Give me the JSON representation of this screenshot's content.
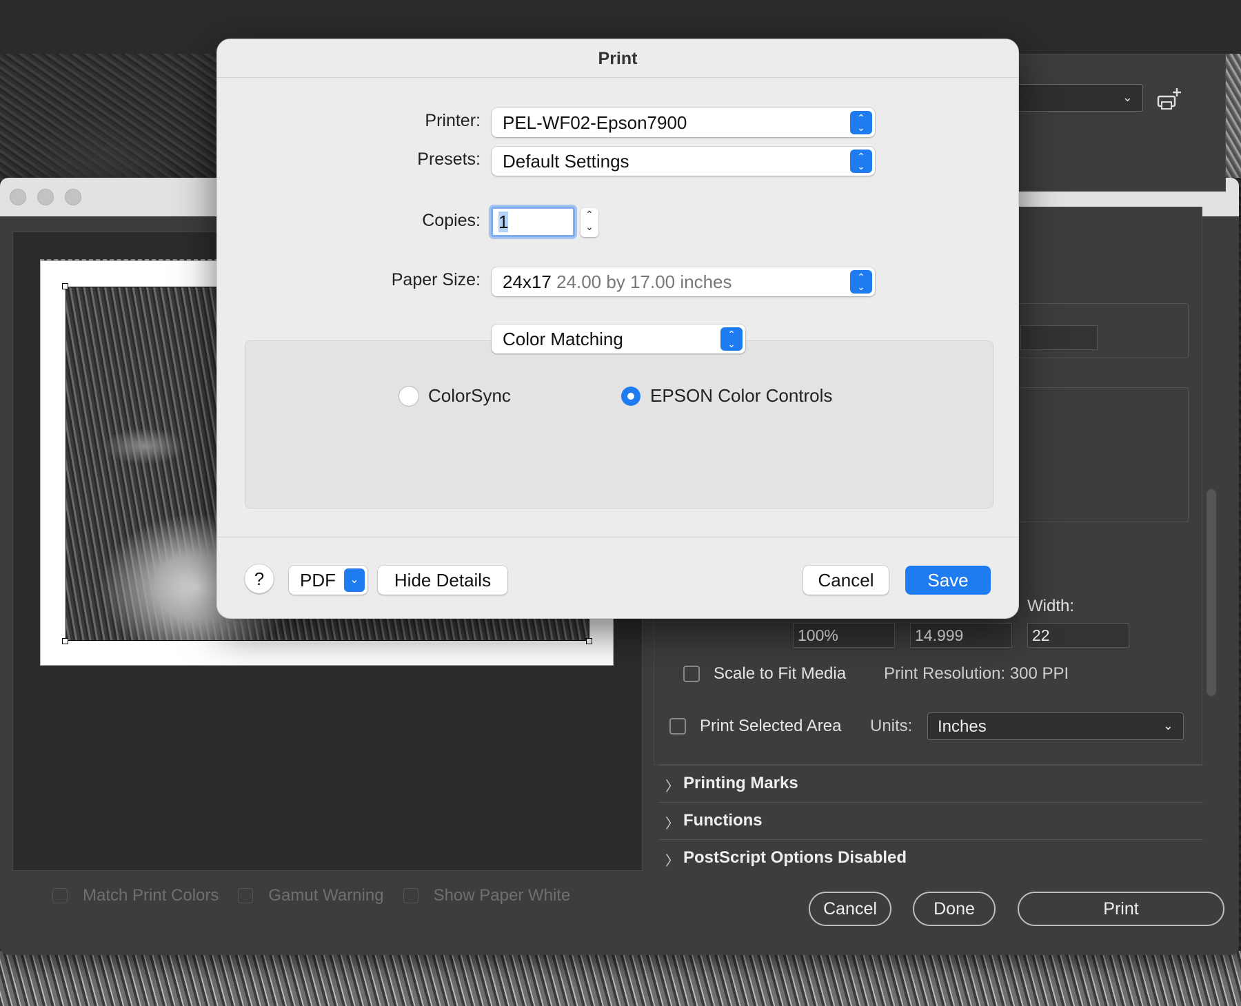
{
  "print_dialog": {
    "title": "Print",
    "printer_label": "Printer:",
    "printer_value": "PEL-WF02-Epson7900",
    "presets_label": "Presets:",
    "presets_value": "Default Settings",
    "copies_label": "Copies:",
    "copies_value": "1",
    "paper_size_label": "Paper Size:",
    "paper_size_name": "24x17",
    "paper_size_detail": "24.00 by 17.00 inches",
    "section_value": "Color Matching",
    "radio_options": [
      {
        "label": "ColorSync",
        "selected": false
      },
      {
        "label": "EPSON Color Controls",
        "selected": true
      }
    ],
    "help_label": "?",
    "pdf_label": "PDF",
    "hide_details_label": "Hide Details",
    "cancel_label": "Cancel",
    "save_label": "Save"
  },
  "photoshop_print": {
    "preview_options": [
      "Match Print Colors",
      "Gamut Warning",
      "Show Paper White"
    ],
    "width_label": "Width:",
    "scale_value": "100%",
    "height_value": "14.999",
    "width_value": "22",
    "scale_to_fit_label": "Scale to Fit Media",
    "print_resolution": "Print Resolution: 300 PPI",
    "print_selected_area_label": "Print Selected Area",
    "units_label": "Units:",
    "units_value": "Inches",
    "sections": [
      "Printing Marks",
      "Functions",
      "PostScript Options Disabled"
    ],
    "cancel_label": "Cancel",
    "done_label": "Done",
    "print_label": "Print"
  },
  "colors": {
    "accent": "#1f7cf0",
    "dialog_bg": "#ececec",
    "dark_panel": "#3d3d3d"
  },
  "icons": [
    "chevron-updown-icon",
    "chevron-down-icon",
    "chevron-right-icon",
    "printer-add-icon"
  ]
}
